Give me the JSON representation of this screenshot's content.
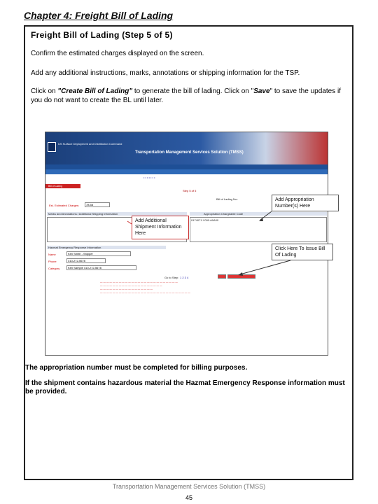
{
  "chapter_title": "Chapter 4:  Freight Bill of Lading",
  "page_title": "Freight Bill of Lading (Step 5 of 5)",
  "paragraphs": {
    "p1": "Confirm the estimated charges displayed on the screen.",
    "p2": "Add any additional instructions, marks, annotations or shipping information for the TSP.",
    "p3a": "Click on ",
    "p3_create": "\"Create Bill of Lading\"",
    "p3b": " to generate the bill of lading.   Click on \"",
    "p3_save": "Save",
    "p3c": "\"  to save the updates if  you do not want to create the BL until later."
  },
  "screenshot": {
    "agency": "US Surface Deployment and Distribution Command",
    "app_title": "Transportation Management Services Solution (TMSS)",
    "tab_label": "Bill of Lading",
    "step": "Step 5 of 5",
    "estimated_charges_label": "Est. Estimated Charges:",
    "estimated_charges_value": "78.58",
    "bl_number_label": "Bill of Lading No.:",
    "marks_label": "Marks and Annotations / Additional Shipping Information",
    "approp_label": "Appropriation Chargeable Code",
    "approp_value": "0174071.Y000.A0A00",
    "hazmat_label": "Hazmat Emergency Response Information",
    "name_label": "Name",
    "name_value": "Ken Smith - Shipper",
    "phone_label": "Phone",
    "phone_value": "410-272-5678",
    "other_label": "Category",
    "other_value": "Ken Sample 410-272-5678",
    "goto_label": "Go to Step:",
    "goto_steps": "1  2  3  4",
    "btn_save": "Save",
    "btn_create": "Create Bill of Lading"
  },
  "callouts": {
    "appropriation": "Add Appropriation Number(s) Here",
    "additional": "Add Additional Shipment Information Here",
    "issue": "Click Here To Issue Bill Of Lading"
  },
  "notes": {
    "n1": "The appropriation number must be completed for billing purposes.",
    "n2": "If the shipment contains hazardous material the Hazmat Emergency Response information must be provided."
  },
  "footer": "Transportation Management Services Solution (TMSS)",
  "page_number": "45"
}
